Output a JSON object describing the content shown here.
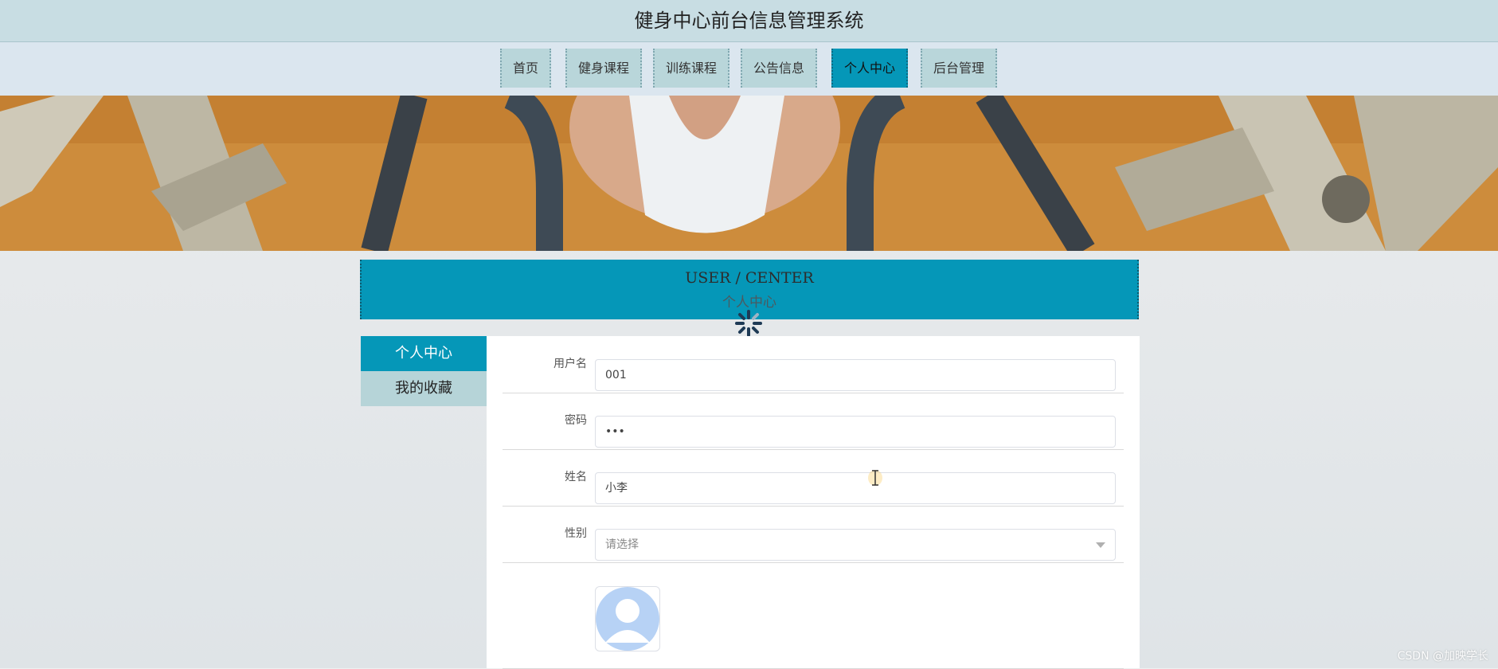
{
  "header": {
    "title": "健身中心前台信息管理系统"
  },
  "nav": {
    "items": [
      {
        "label": "首页"
      },
      {
        "label": "健身课程"
      },
      {
        "label": "训练课程"
      },
      {
        "label": "公告信息"
      },
      {
        "label": "个人中心",
        "active": true
      },
      {
        "label": "后台管理"
      }
    ]
  },
  "section": {
    "title_en": "USER / CENTER",
    "title_cn": "个人中心"
  },
  "sidebar": {
    "items": [
      {
        "label": "个人中心",
        "active": true
      },
      {
        "label": "我的收藏"
      }
    ]
  },
  "form": {
    "username": {
      "label": "用户名",
      "value": "001"
    },
    "password": {
      "label": "密码",
      "value": "•••"
    },
    "name": {
      "label": "姓名",
      "value": "小李"
    },
    "gender": {
      "label": "性别",
      "placeholder": "请选择"
    },
    "avatar": {
      "icon": "user-avatar-icon"
    }
  },
  "watermark": "CSDN @加映学长",
  "colors": {
    "accent": "#0597b8",
    "nav_bg": "#b9d6da",
    "topbar": "#c8dde3"
  }
}
